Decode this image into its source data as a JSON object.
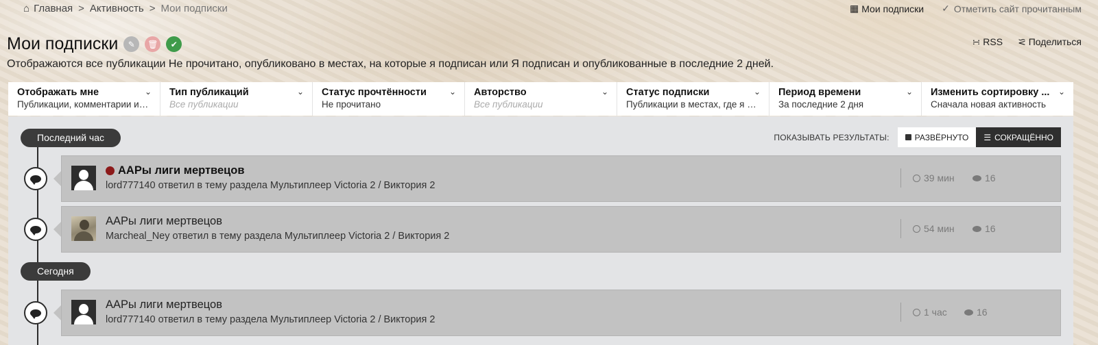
{
  "breadcrumb": {
    "home": "Главная",
    "activity": "Активность",
    "current": "Мои подписки",
    "sep": ">"
  },
  "toplinks": {
    "subs": "Мои подписки",
    "mark_read": "Отметить сайт прочитанным"
  },
  "page": {
    "title": "Мои подписки",
    "rss": "RSS",
    "share": "Поделиться",
    "description": "Отображаются все публикации Не прочитано, опубликовано в местах, на которые я подписан или Я подписан и опубликованные в последние 2 дней."
  },
  "filters": [
    {
      "title": "Отображать мне",
      "value": "Публикации, комментарии и ответы"
    },
    {
      "title": "Тип публикаций",
      "value": "Все публикации",
      "placeholder": true
    },
    {
      "title": "Статус прочтённости",
      "value": "Не прочитано"
    },
    {
      "title": "Авторство",
      "value": "Все публикации",
      "placeholder": true
    },
    {
      "title": "Статус подписки",
      "value": "Публикации в местах, где я подписан"
    },
    {
      "title": "Период времени",
      "value": "За последние 2 дня"
    },
    {
      "title": "Изменить сортировку ...",
      "value": "Сначала новая активность"
    }
  ],
  "controls": {
    "label": "ПОКАЗЫВАТЬ РЕЗУЛЬТАТЫ:",
    "expanded": "РАЗВЁРНУТО",
    "condensed": "СОКРАЩЁННО"
  },
  "groups": {
    "last_hour": "Последний час",
    "today": "Сегодня"
  },
  "items": [
    {
      "title": "ААРы лиги мертвецов",
      "subtitle": "lord777140 ответил в тему раздела Мультиплеер Victoria 2 / Виктория 2",
      "time": "39 мин",
      "comments": "16",
      "unread": true
    },
    {
      "title": "ААРы лиги мертвецов",
      "subtitle": "Marcheal_Ney ответил в тему раздела Мультиплеер Victoria 2 / Виктория 2",
      "time": "54 мин",
      "comments": "16",
      "unread": false
    },
    {
      "title": "ААРы лиги мертвецов",
      "subtitle": "lord777140 ответил в тему раздела Мультиплеер Victoria 2 / Виктория 2",
      "time": "1 час",
      "comments": "16",
      "unread": false
    }
  ]
}
